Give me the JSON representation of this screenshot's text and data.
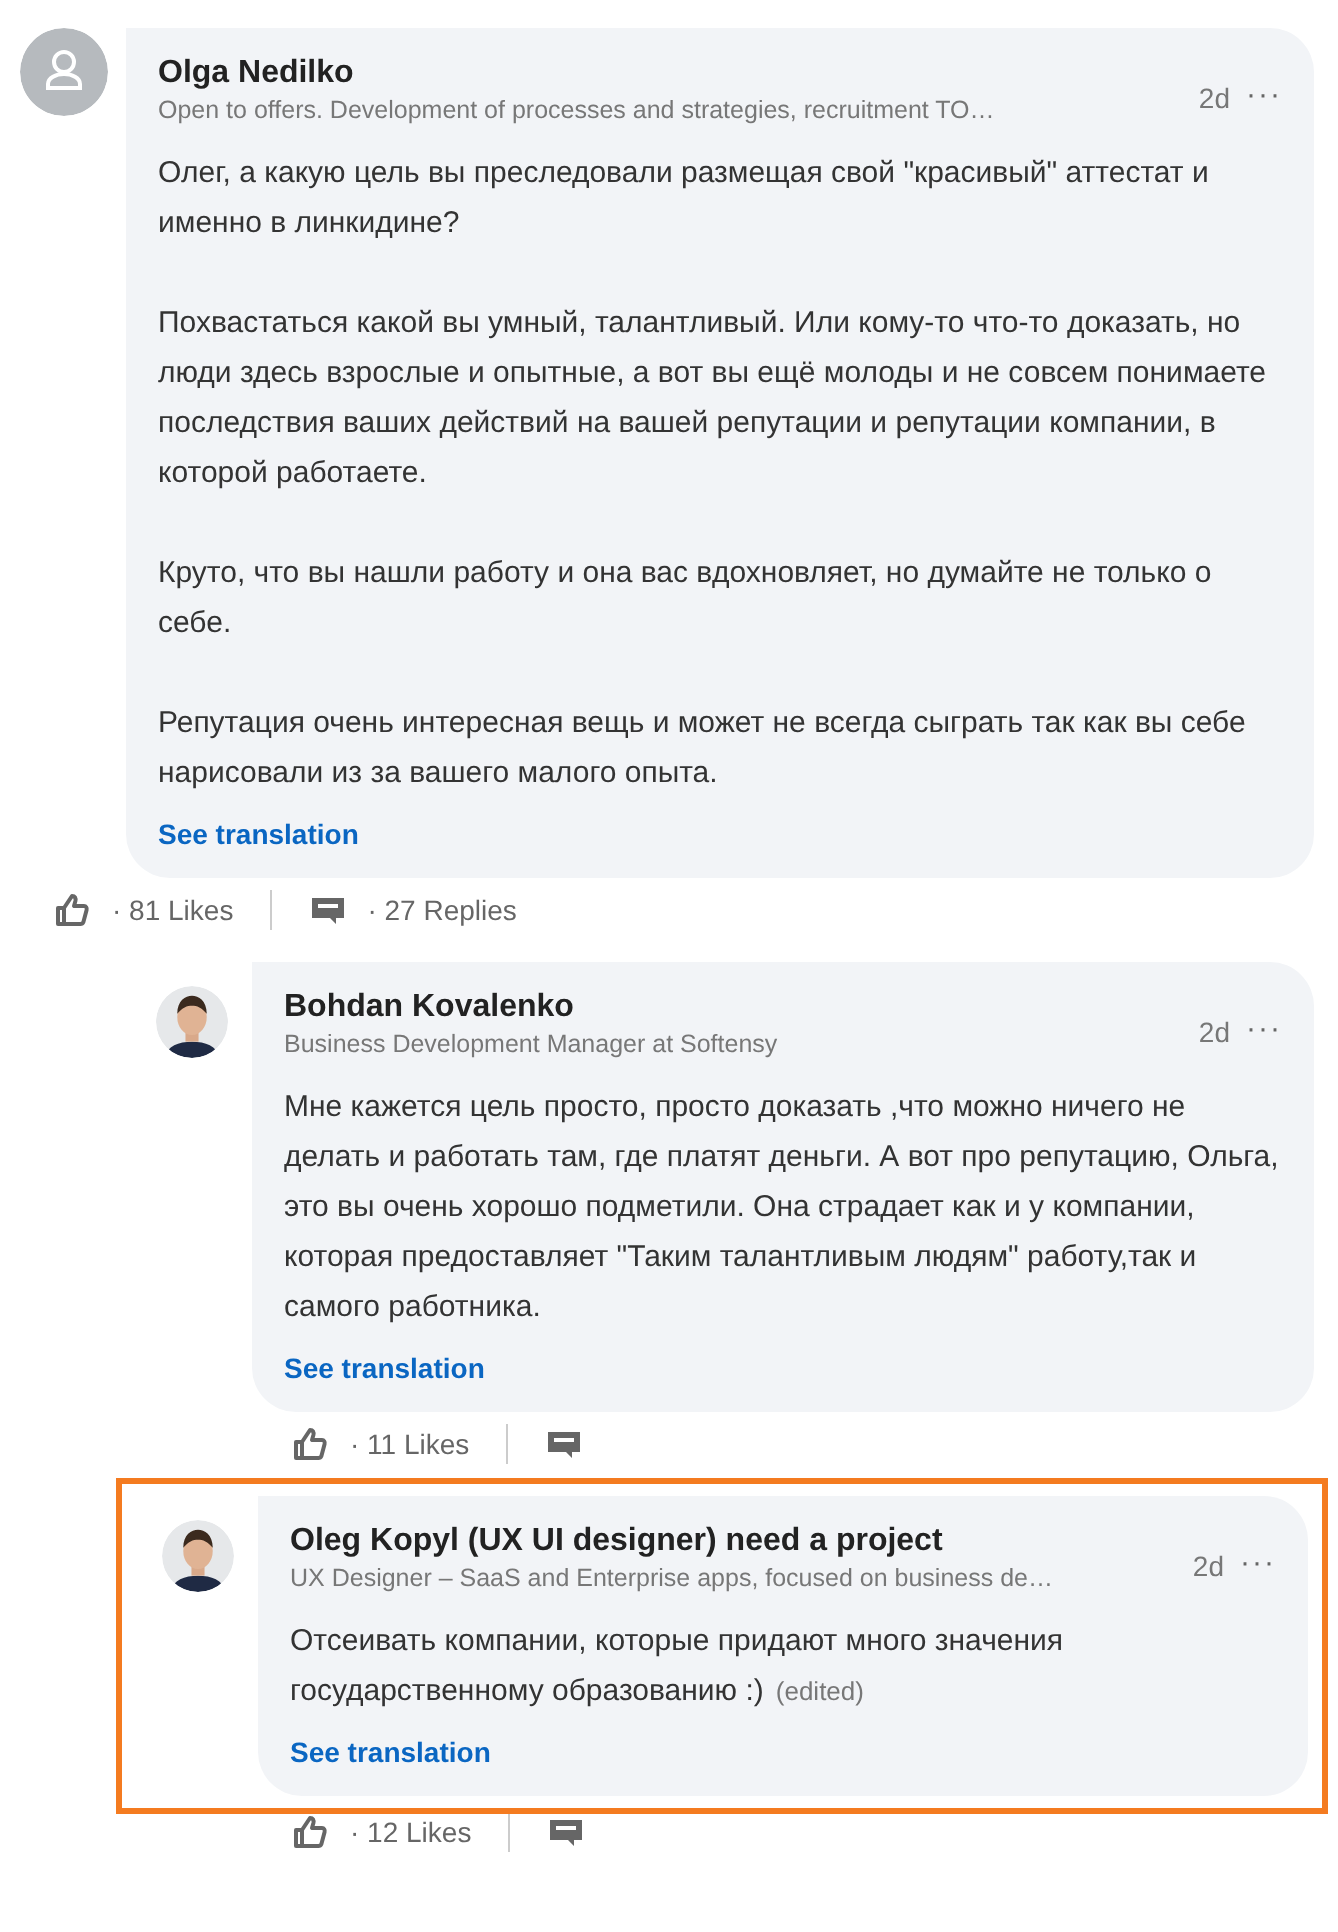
{
  "comments": [
    {
      "avatar": {
        "kind": "placeholder"
      },
      "author": "Olga Nedilko",
      "headline": "Open to offers. Development of processes and strategies, recruitment TO…",
      "time": "2d",
      "more": "···",
      "highlighted": false,
      "paragraphs": [
        "Олег, а какую цель вы преследовали размещая свой \"красивый\" аттестат и именно в линкидине?",
        "Похвастаться какой вы умный, талантливый. Или кому-то что-то доказать, но люди здесь взрослые и опытные, а вот вы ещё молоды и не совсем понимаете последствия ваших действий на вашей репутации и репутации компании, в которой работаете.",
        "Круто, что вы нашли работу и она вас вдохновляет, но думайте не только о себе.",
        "Репутация очень интересная вещь и может не всегда сыграть так как вы себе нарисовали из за вашего малого опыта."
      ],
      "translation": "See translation",
      "likes": "· 81 Likes",
      "replies": "· 27 Replies",
      "children": [
        {
          "avatar": {
            "kind": "photo"
          },
          "author": "Bohdan Kovalenko",
          "headline": "Business Development Manager at Softensy",
          "time": "2d",
          "more": "···",
          "highlighted": false,
          "paragraphs": [
            "Мне кажется цель просто, просто доказать ,что можно ничего не делать и работать там, где платят деньги. А вот про репутацию, Ольга, это вы очень хорошо подметили. Она страдает как и у компании, которая предоставляет \"Таким талантливым людям\" работу,так и самого работника."
          ],
          "translation": "See translation",
          "likes": "· 11 Likes"
        },
        {
          "avatar": {
            "kind": "photo"
          },
          "author": "Oleg Kopyl (UX UI designer) need a project",
          "headline": "UX Designer – SaaS and Enterprise apps, focused on business de…",
          "time": "2d",
          "more": "···",
          "highlighted": true,
          "paragraphs": [
            "Отсеивать компании, которые придают много значения государственному образованию :)"
          ],
          "edited": "(edited)",
          "translation": "See translation",
          "likes": "· 12 Likes"
        }
      ]
    }
  ]
}
